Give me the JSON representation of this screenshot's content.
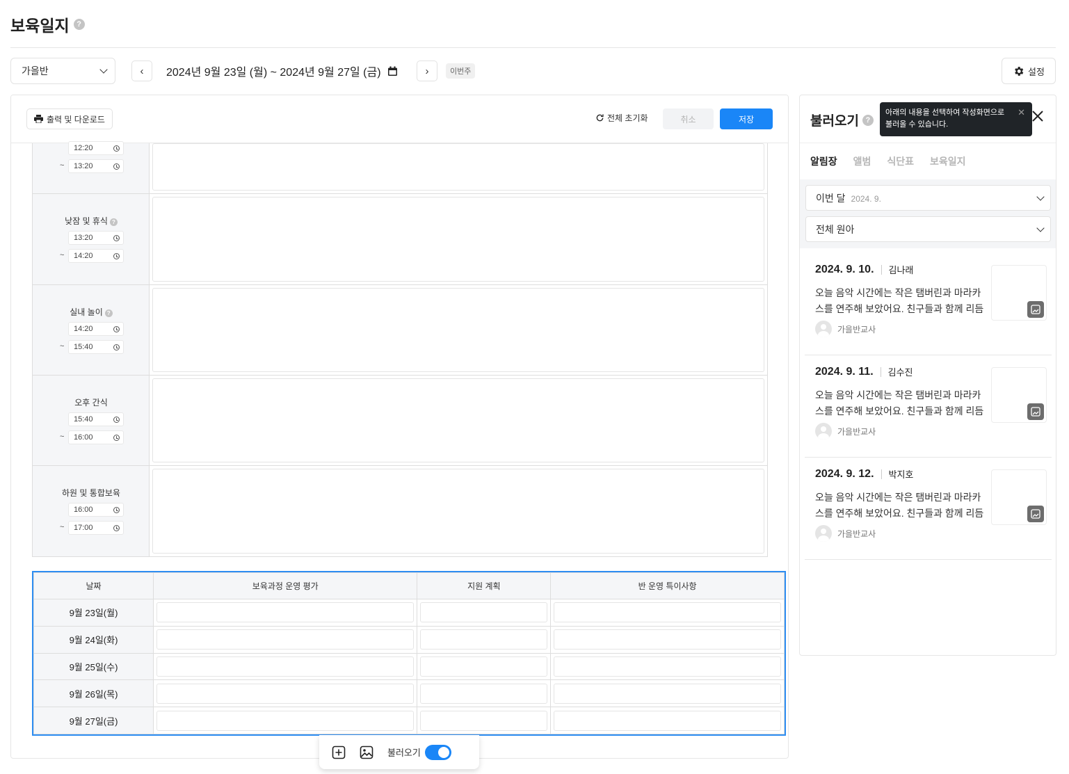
{
  "page": {
    "title": "보육일지"
  },
  "topbar": {
    "class_select": "가을반",
    "date_range": "2024년 9월 23일 (월) ~ 2024년 9월 27일 (금)",
    "this_week": "이번주",
    "settings_label": "설정"
  },
  "toolbar": {
    "print_label": "출력 및 다운로드",
    "reset_label": "전체 초기화",
    "cancel_label": "취소",
    "save_label": "저장"
  },
  "schedule": [
    {
      "name": "",
      "start": "12:20",
      "end": "13:20",
      "help": false
    },
    {
      "name": "낮잠 및 휴식",
      "start": "13:20",
      "end": "14:20",
      "help": true
    },
    {
      "name": "실내 놀이",
      "start": "14:20",
      "end": "15:40",
      "help": true
    },
    {
      "name": "오후 간식",
      "start": "15:40",
      "end": "16:00",
      "help": false
    },
    {
      "name": "하원 및 통합보육",
      "start": "16:00",
      "end": "17:00",
      "help": false
    }
  ],
  "evaluation": {
    "headers": [
      "날짜",
      "보육과정 운영 평가",
      "지원 계획",
      "반 운영 특이사항"
    ],
    "rows": [
      "9월 23일(월)",
      "9월 24일(화)",
      "9월 25일(수)",
      "9월 26일(목)",
      "9월 27일(금)"
    ]
  },
  "floatbar": {
    "load_label": "불러오기",
    "load_enabled": true
  },
  "right_panel": {
    "title": "불러오기",
    "tooltip": "아래의 내용을 선택하여 작성화면으로 불러올 수 있습니다.",
    "tooltip_line1": "아래의 내용을 선택하여 작성화면으로",
    "tooltip_line2": "불러올 수 있습니다.",
    "tabs": [
      "알림장",
      "앨범",
      "식단표",
      "보육일지"
    ],
    "active_tab": "알림장",
    "month_filter": "이번 달",
    "month_value": "2024. 9.",
    "child_filter": "전체 원아",
    "cards": [
      {
        "date": "2024. 9. 10.",
        "name": "김나래",
        "line1": "오늘 음악 시간에는 작은 탬버린과 마라카",
        "line2": "스를 연주해 보았어요. 친구들과 함께 리듬",
        "author": "가을반교사"
      },
      {
        "date": "2024. 9. 11.",
        "name": "김수진",
        "line1": "오늘 음악 시간에는 작은 탬버린과 마라카",
        "line2": "스를 연주해 보았어요. 친구들과 함께 리듬",
        "author": "가을반교사"
      },
      {
        "date": "2024. 9. 12.",
        "name": "박지호",
        "line1": "오늘 음악 시간에는 작은 탬버린과 마라카",
        "line2": "스를 연주해 보았어요. 친구들과 함께 리듬",
        "author": "가을반교사"
      }
    ]
  },
  "colors": {
    "primary": "#1a86f7",
    "highlight_border": "#2d8df2",
    "label_bg": "#f5f6f8"
  }
}
